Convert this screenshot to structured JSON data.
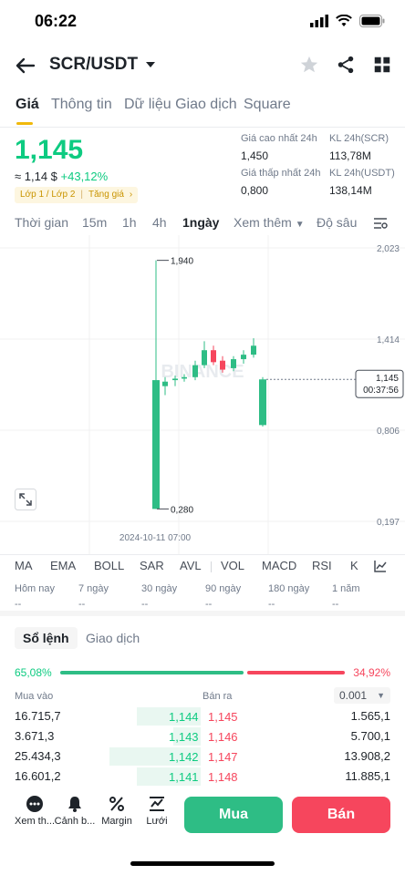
{
  "status": {
    "time": "06:22"
  },
  "header": {
    "pair": "SCR/USDT"
  },
  "tabs": [
    "Giá",
    "Thông tin",
    "Dữ liệu Giao dịch",
    "Square"
  ],
  "price": {
    "last": "1,145",
    "approx": "≈ 1,14 $",
    "change": "+43,12%",
    "tag1": "Lớp 1 / Lớp 2",
    "tag2": "Tăng giá"
  },
  "stats": {
    "high_label": "Giá cao nhất 24h",
    "high": "1,450",
    "low_label": "Giá thấp nhất 24h",
    "low": "0,800",
    "vol_scr_label": "KL 24h(SCR)",
    "vol_scr": "113,78M",
    "vol_usdt_label": "KL 24h(USDT)",
    "vol_usdt": "138,14M"
  },
  "intervals": [
    "Thời gian",
    "15m",
    "1h",
    "4h",
    "1ngày",
    "Xem thêm",
    "Độ sâu"
  ],
  "chart_data": {
    "type": "candlestick",
    "y_ticks": [
      "2,023",
      "1,414",
      "0,806",
      "0,197"
    ],
    "ylim": [
      0.197,
      2.023
    ],
    "high_label": "1,940",
    "low_label": "0,280",
    "last_price": "1,145",
    "countdown": "00:37:56",
    "x_label": "2024-10-11 07:00",
    "watermark": "BINANCE",
    "candles": [
      {
        "o": 0.28,
        "c": 1.14,
        "h": 1.94,
        "l": 0.28,
        "dir": "up"
      },
      {
        "o": 1.1,
        "c": 1.13,
        "h": 1.16,
        "l": 1.04,
        "dir": "up"
      },
      {
        "o": 1.14,
        "c": 1.15,
        "h": 1.17,
        "l": 1.1,
        "dir": "up"
      },
      {
        "o": 1.15,
        "c": 1.16,
        "h": 1.18,
        "l": 1.13,
        "dir": "up"
      },
      {
        "o": 1.16,
        "c": 1.24,
        "h": 1.27,
        "l": 1.14,
        "dir": "up"
      },
      {
        "o": 1.24,
        "c": 1.34,
        "h": 1.4,
        "l": 1.22,
        "dir": "up"
      },
      {
        "o": 1.34,
        "c": 1.26,
        "h": 1.37,
        "l": 1.24,
        "dir": "down"
      },
      {
        "o": 1.27,
        "c": 1.21,
        "h": 1.3,
        "l": 1.19,
        "dir": "down"
      },
      {
        "o": 1.22,
        "c": 1.28,
        "h": 1.3,
        "l": 1.2,
        "dir": "up"
      },
      {
        "o": 1.28,
        "c": 1.31,
        "h": 1.34,
        "l": 1.25,
        "dir": "up"
      },
      {
        "o": 1.31,
        "c": 1.37,
        "h": 1.42,
        "l": 1.29,
        "dir": "up"
      },
      {
        "o": 1.145,
        "c": 0.84,
        "h": 1.16,
        "l": 0.83,
        "dir": "up_bar"
      }
    ]
  },
  "indicators": [
    "MA",
    "EMA",
    "BOLL",
    "SAR",
    "AVL",
    "VOL",
    "MACD",
    "RSI",
    "K"
  ],
  "periods": [
    {
      "label": "Hôm nay",
      "value": "--"
    },
    {
      "label": "7 ngày",
      "value": "--"
    },
    {
      "label": "30 ngày",
      "value": "--"
    },
    {
      "label": "90 ngày",
      "value": "--"
    },
    {
      "label": "180 ngày",
      "value": "--"
    },
    {
      "label": "1 năm",
      "value": "--"
    }
  ],
  "orderbook": {
    "tab_book": "Sổ lệnh",
    "tab_trades": "Giao dịch",
    "buy_pct": "65,08%",
    "sell_pct": "34,92%",
    "buy_ratio": 0.6508,
    "buy_head": "Mua vào",
    "sell_head": "Bán ra",
    "precision": "0.001",
    "rows": [
      {
        "bid_qty": "16.715,7",
        "bid": "1,144",
        "ask": "1,145",
        "ask_qty": "1.565,1"
      },
      {
        "bid_qty": "3.671,3",
        "bid": "1,143",
        "ask": "1,146",
        "ask_qty": "5.700,1"
      },
      {
        "bid_qty": "25.434,3",
        "bid": "1,142",
        "ask": "1,147",
        "ask_qty": "13.908,2"
      },
      {
        "bid_qty": "16.601,2",
        "bid": "1,141",
        "ask": "1,148",
        "ask_qty": "11.885,1"
      }
    ]
  },
  "bottom": {
    "more": "Xem th...",
    "alert": "Cảnh b...",
    "margin": "Margin",
    "grid": "Lưới",
    "buy": "Mua",
    "sell": "Bán"
  },
  "colors": {
    "up": "#2ebd85",
    "down": "#f6465d",
    "accent": "#f0b90b"
  }
}
